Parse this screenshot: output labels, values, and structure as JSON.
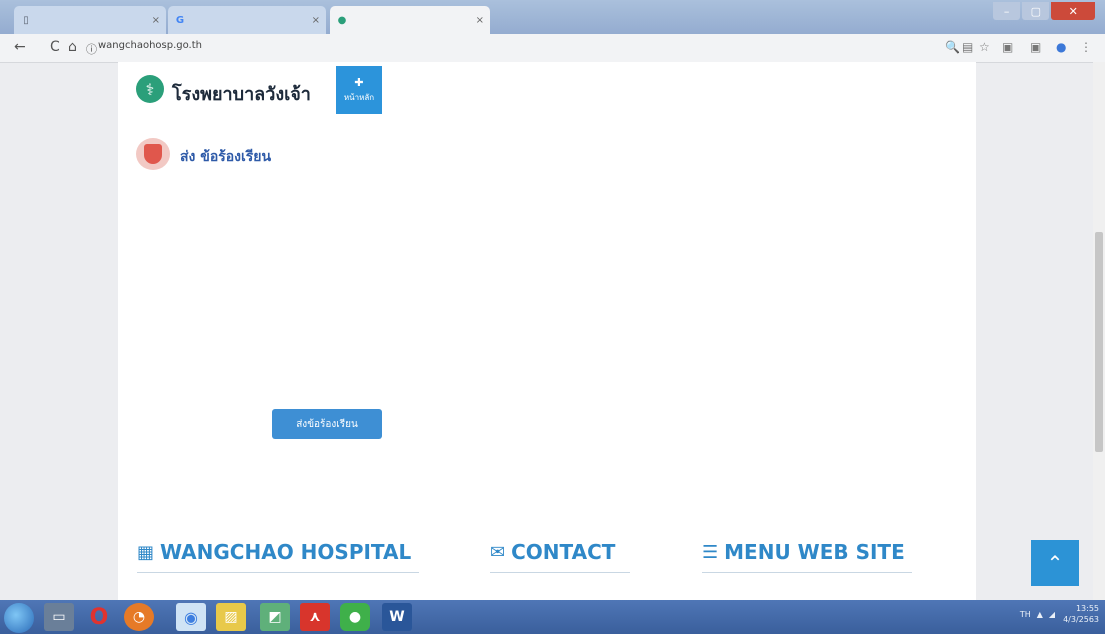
{
  "browser": {
    "tabs": [
      {
        "label": "",
        "icon": "page-icon",
        "active": false
      },
      {
        "label": "",
        "icon": "google-icon",
        "active": false
      },
      {
        "label": "",
        "icon": "hospital-favicon",
        "active": true
      }
    ],
    "url_host": "wangchaohosp.go.th",
    "url_path": "",
    "tab_close_glyph": "×"
  },
  "site": {
    "name": "โรงพยาบาลวังเจ้า",
    "home_label": "หน้าหลัก",
    "nav_items": [
      "",
      "",
      "",
      "",
      "",
      ""
    ],
    "brand_color": "#2c94db"
  },
  "complaint": {
    "title": "ส่ง ข้อร้องเรียน",
    "fields": [
      {
        "label": "",
        "placeholder": ""
      },
      {
        "label": "",
        "placeholder": ""
      },
      {
        "label": "",
        "placeholder": ""
      },
      {
        "label": "",
        "placeholder": ""
      },
      {
        "label": "",
        "placeholder": ""
      }
    ],
    "submit_label": "ส่งข้อร้องเรียน"
  },
  "footer": {
    "hospital": "WANGCHAO HOSPITAL",
    "contact": "CONTACT",
    "menu": "MENU WEB SITE"
  },
  "taskbar": {
    "apps": [
      "explorer",
      "opera",
      "firefox",
      "chrome",
      "photos",
      "maps",
      "acrobat",
      "line",
      "word"
    ],
    "word_glyph": "W",
    "lang": "TH",
    "time": "13:55",
    "date": "4/3/2563"
  }
}
